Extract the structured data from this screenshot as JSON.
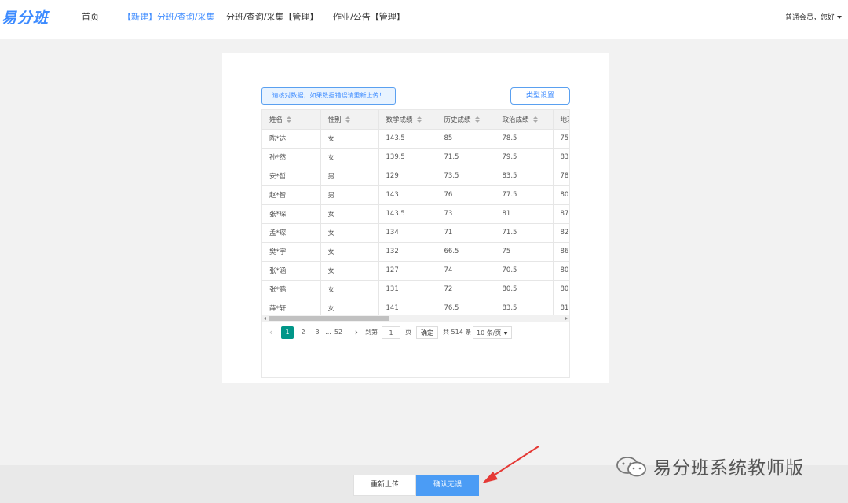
{
  "header": {
    "logo": "易分班",
    "nav": [
      {
        "label": "首页",
        "active": false
      },
      {
        "label": "【新建】分班/查询/采集",
        "active": true
      },
      {
        "label": "分班/查询/采集【管理】",
        "active": false
      },
      {
        "label": "作业/公告【管理】",
        "active": false
      }
    ],
    "user": "普通会员，您好"
  },
  "card": {
    "notice": "请核对数据，如果数据错误请重新上传！",
    "type_button": "类型设置"
  },
  "table": {
    "columns": [
      "姓名",
      "性别",
      "数学成绩",
      "历史成绩",
      "政治成绩",
      "地理"
    ],
    "rows": [
      [
        "陈*达",
        "女",
        "143.5",
        "85",
        "78.5",
        "75"
      ],
      [
        "孙*然",
        "女",
        "139.5",
        "71.5",
        "79.5",
        "83"
      ],
      [
        "安*哲",
        "男",
        "129",
        "73.5",
        "83.5",
        "78"
      ],
      [
        "赵*智",
        "男",
        "143",
        "76",
        "77.5",
        "80"
      ],
      [
        "张*琛",
        "女",
        "143.5",
        "73",
        "81",
        "87"
      ],
      [
        "孟*琛",
        "女",
        "134",
        "71",
        "71.5",
        "82"
      ],
      [
        "樊*宇",
        "女",
        "132",
        "66.5",
        "75",
        "86"
      ],
      [
        "张*涵",
        "女",
        "127",
        "74",
        "70.5",
        "80"
      ],
      [
        "张*鹏",
        "女",
        "131",
        "72",
        "80.5",
        "80"
      ],
      [
        "薛*轩",
        "女",
        "141",
        "76.5",
        "83.5",
        "81"
      ]
    ]
  },
  "pagination": {
    "prev": "‹",
    "pages": [
      "1",
      "2",
      "3",
      "...",
      "52"
    ],
    "current": "1",
    "next": "›",
    "goto_label": "到第",
    "goto_value": "1",
    "page_unit": "页",
    "confirm": "确定",
    "total": "共 514 条",
    "page_size": "10 条/页"
  },
  "footer": {
    "reupload": "重新上传",
    "confirm": "确认无误"
  },
  "watermark": {
    "text": "易分班系统教师版"
  },
  "colors": {
    "brand": "#3d8bff",
    "pager_active": "#009688",
    "confirm_button": "#4b9cf5",
    "arrow": "#e53935"
  }
}
